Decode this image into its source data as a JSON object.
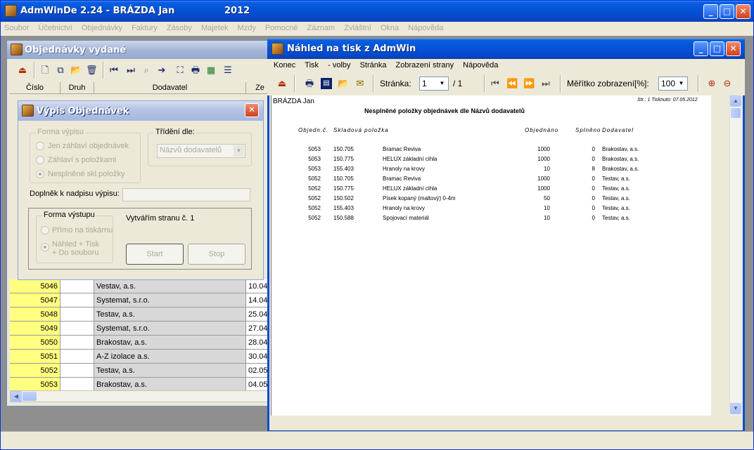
{
  "app": {
    "title": "AdmWinDe 2.24 - BRÁZDA Jan",
    "year": "2012",
    "menu": [
      "Soubor",
      "Účetnictví",
      "Objednávky",
      "Faktury",
      "Zásoby",
      "Majetek",
      "Mzdy",
      "Pomocné",
      "Záznam",
      "Zvláštní",
      "Okna",
      "Nápověda"
    ]
  },
  "orders_window": {
    "title": "Objednávky vydané",
    "columns": [
      "Číslo",
      "Druh",
      "Dodavatel",
      "Ze"
    ],
    "rows": [
      {
        "num": "5046",
        "kind": "",
        "supplier": "Vestav, a.s.",
        "date": "10.04"
      },
      {
        "num": "5047",
        "kind": "",
        "supplier": "Systemat, s.r.o.",
        "date": "14.04"
      },
      {
        "num": "5048",
        "kind": "",
        "supplier": "Testav, a.s.",
        "date": "25.04"
      },
      {
        "num": "5049",
        "kind": "",
        "supplier": "Systemat, s.r.o.",
        "date": "27.04"
      },
      {
        "num": "5050",
        "kind": "",
        "supplier": "Brakostav, a.s.",
        "date": "28.04"
      },
      {
        "num": "5051",
        "kind": "",
        "supplier": "A-Z izolace a.s.",
        "date": "30.04"
      },
      {
        "num": "5052",
        "kind": "",
        "supplier": "Testav, a.s.",
        "date": "02.05"
      },
      {
        "num": "5053",
        "kind": "",
        "supplier": "Brakostav, a.s.",
        "date": "04.05"
      }
    ]
  },
  "dialog": {
    "title": "Výpis Objednávek",
    "output_form_label": "Forma výpisu",
    "options": [
      "Jen záhlaví objednávek",
      "Záhlaví s položkami",
      "Nesplněné skl.položky"
    ],
    "sort_label": "Třídění dle:",
    "sort_value": "Názvů dodavatelů",
    "heading_addon_label": "Doplněk k nadpisu výpisu:",
    "heading_addon_value": "",
    "output_label": "Forma výstupu",
    "output_options": [
      "Přímo na tiskárnu",
      "Náhled + Tisk",
      "+ Do souboru"
    ],
    "progress_text": "Vytvářím stranu č.  1",
    "start_label": "Start",
    "stop_label": "Stop"
  },
  "preview": {
    "title": "Náhled na tisk z AdmWin",
    "menu": [
      "Konec",
      "Tisk",
      "- volby",
      "Stránka",
      "Zobrazení strany",
      "Nápověda"
    ],
    "page_label": "Stránka:",
    "page_value": "1",
    "page_total": "/ 1",
    "zoom_label": "Měřítko zobrazení[%]:",
    "zoom_value": "100",
    "report": {
      "company": "BRÁZDA Jan",
      "page_info": "Str.: 1   Tisknuto: 07.05.2012",
      "heading": "Nesplněné položky objednávek dle Názvů dodavatelů",
      "columns": [
        "Objedn.č.",
        "Skladová položka",
        "Objednáno",
        "Splněno",
        "Dodavatel"
      ],
      "rows": [
        {
          "order": "5053",
          "code": "150.705",
          "name": "Bramac Reviva",
          "ordered": "1000",
          "done": "0",
          "supplier": "Brakostav, a.s."
        },
        {
          "order": "5053",
          "code": "150.775",
          "name": "HELUX základní cihla",
          "ordered": "1000",
          "done": "0",
          "supplier": "Brakostav, a.s."
        },
        {
          "order": "5053",
          "code": "155.403",
          "name": "Hranoly na krovy",
          "ordered": "10",
          "done": "8",
          "supplier": "Brakostav, a.s."
        },
        {
          "order": "5052",
          "code": "150.705",
          "name": "Bramac Reviva",
          "ordered": "1000",
          "done": "0",
          "supplier": "Testav, a.s."
        },
        {
          "order": "5052",
          "code": "150.775",
          "name": "HELUX základní cihla",
          "ordered": "1000",
          "done": "0",
          "supplier": "Testav, a.s."
        },
        {
          "order": "5052",
          "code": "150.502",
          "name": "Písek kopaný (maltový) 0-4m",
          "ordered": "50",
          "done": "0",
          "supplier": "Testav, a.s."
        },
        {
          "order": "5052",
          "code": "155.403",
          "name": "Hranoly na krovy",
          "ordered": "10",
          "done": "0",
          "supplier": "Testav, a.s."
        },
        {
          "order": "5052",
          "code": "150.588",
          "name": "Spojovací materiál",
          "ordered": "10",
          "done": "0",
          "supplier": "Testav, a.s."
        }
      ]
    }
  }
}
